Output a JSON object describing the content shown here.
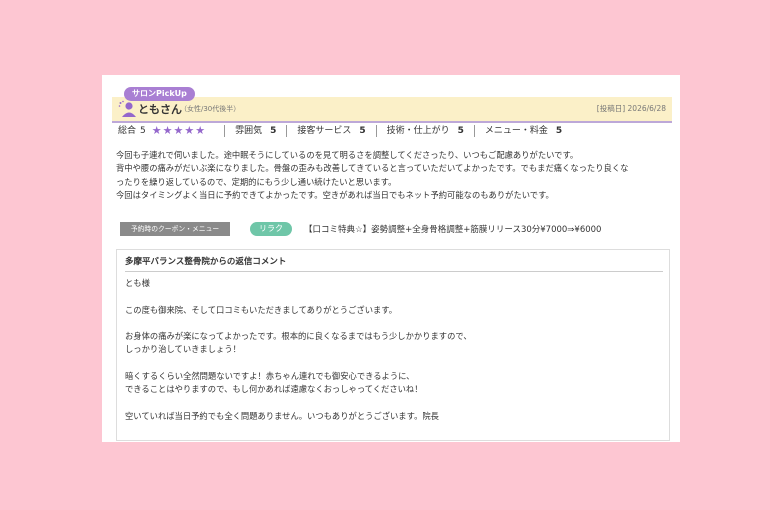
{
  "review": {
    "badge": "サロンPickUp",
    "reviewer_name": "ともさん",
    "reviewer_attr": "（女性/30代後半）",
    "posted_date": "[投稿日] 2026/6/28",
    "ratings": {
      "overall_label": "総合",
      "overall_value": "5",
      "stars": "★★★★★",
      "items": [
        {
          "label": "雰囲気",
          "value": "5"
        },
        {
          "label": "接客サービス",
          "value": "5"
        },
        {
          "label": "技術・仕上がり",
          "value": "5"
        },
        {
          "label": "メニュー・料金",
          "value": "5"
        }
      ]
    },
    "body_lines": [
      "今回も子連れで伺いました。途中眠そうにしているのを見て明るさを調整してくださったり、いつもご配慮ありがたいです。",
      "背中や腰の痛みがだいぶ楽になりました。骨盤の歪みも改善してきていると言っていただいてよかったです。でもまだ痛くなったり良くな",
      "ったりを繰り返しているので、定期的にもう少し通い続けたいと思います。",
      "今回はタイミングよく当日に予約できてよかったです。空きがあれば当日でもネット予約可能なのもありがたいです。"
    ],
    "coupon": {
      "label": "予約時のクーポン・メニュー",
      "tag": "リラク",
      "text": "【口コミ特典☆】姿勢調整+全身骨格調整+筋膜リリース30分¥7000⇒¥6000"
    },
    "reply": {
      "title": "多摩平バランス整骨院からの返信コメント",
      "paragraphs": [
        [
          "とも様"
        ],
        [
          "この度も御来院、そして口コミもいただきましてありがとうございます。"
        ],
        [
          "お身体の痛みが楽になってよかったです。根本的に良くなるまではもう少しかかりますので、",
          "しっかり治していきましょう！"
        ],
        [
          "暗くするくらい全然問題ないですよ！赤ちゃん連れでも御安心できるように、",
          "できることはやりますので、もし何かあれば遠慮なくおっしゃってくださいね！"
        ],
        [
          "空いていれば当日予約でも全く問題ありません。いつもありがとうございます。院長"
        ]
      ]
    }
  },
  "colors": {
    "background": "#fdc6d2",
    "badge": "#a97fd3",
    "header_bg": "#fbf0c8",
    "stars": "#9467cc",
    "tag": "#6fc6a8"
  }
}
